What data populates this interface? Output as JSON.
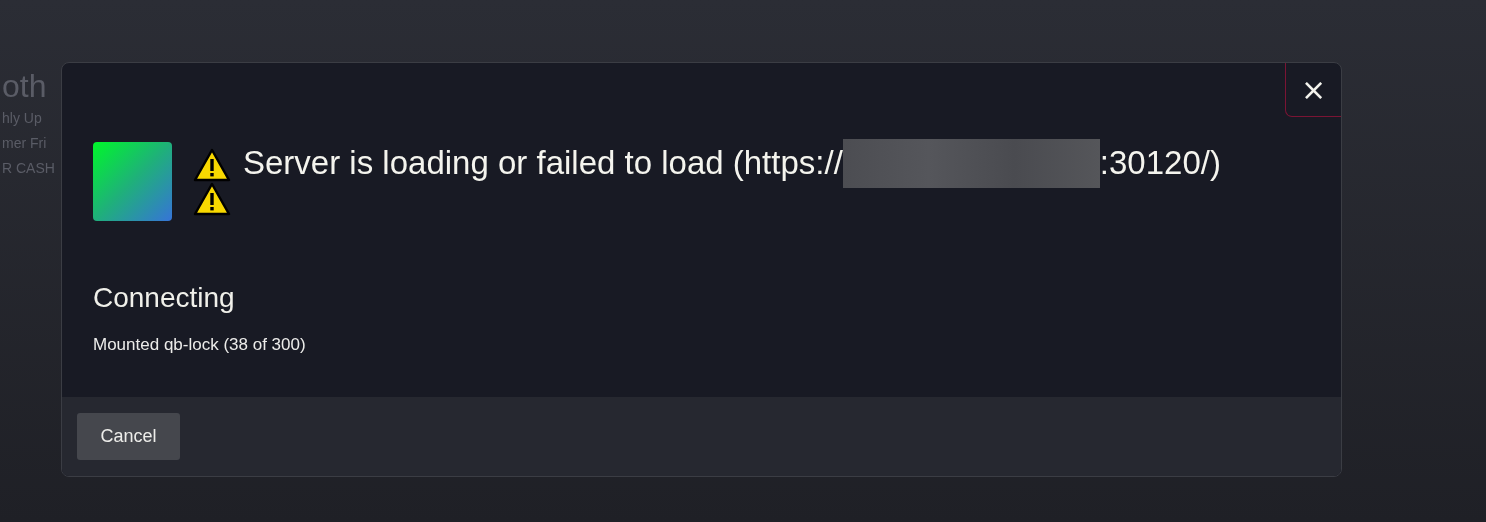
{
  "background": {
    "heading": "oth",
    "lines": [
      "hly Up",
      "mer Fri",
      "R CASH"
    ]
  },
  "dialog": {
    "title_start": "Server is loading or failed to load (https://",
    "title_end": ":30120/)",
    "status": "Connecting",
    "detail": "Mounted qb-lock (38 of 300)",
    "close": "×",
    "buttons": [
      "Cancel"
    ]
  }
}
